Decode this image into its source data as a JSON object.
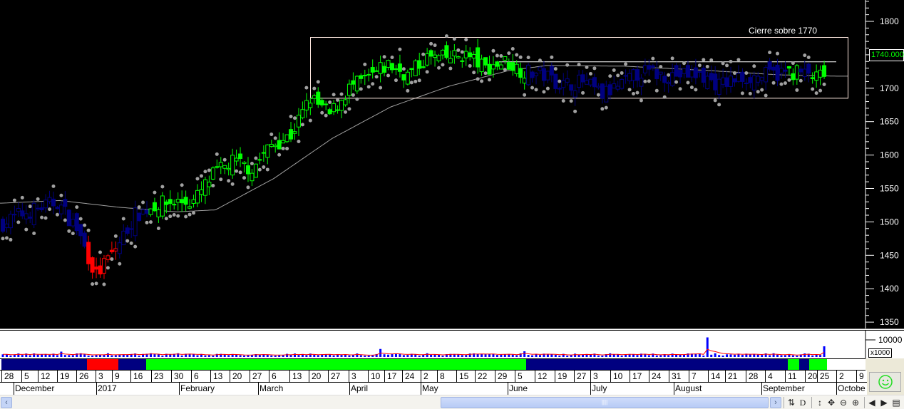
{
  "chart_data": {
    "type": "candlestick",
    "title": "",
    "annotation_label": "Cierre sobre 1770",
    "annotation_box_price": [
      1685,
      1776
    ],
    "reference_line_price": 1740,
    "current_price_label": "1740.000",
    "ylim": [
      1340,
      1830
    ],
    "y_ticks": [
      "1800",
      "1750",
      "1700",
      "1650",
      "1600",
      "1550",
      "1500",
      "1450",
      "1400",
      "1350"
    ],
    "y_tick_values": [
      1800,
      1750,
      1700,
      1650,
      1600,
      1550,
      1500,
      1450,
      1400,
      1350
    ],
    "start_close": 1495,
    "weekly_closes": [
      1510,
      1520,
      1530,
      1490,
      1420,
      1460,
      1510,
      1525,
      1530,
      1530,
      1570,
      1590,
      1580,
      1615,
      1630,
      1685,
      1660,
      1700,
      1715,
      1735,
      1720,
      1745,
      1745,
      1750,
      1730,
      1740,
      1725,
      1720,
      1705,
      1710,
      1690,
      1705,
      1725,
      1720,
      1720,
      1720,
      1705,
      1715,
      1718,
      1722,
      1725,
      1715,
      1730,
      1740
    ],
    "moving_average": [
      [
        0,
        1528
      ],
      [
        3,
        1532
      ],
      [
        6,
        1522
      ],
      [
        9,
        1515
      ],
      [
        11,
        1518
      ],
      [
        14,
        1565
      ],
      [
        17,
        1625
      ],
      [
        20,
        1672
      ],
      [
        23,
        1703
      ],
      [
        26,
        1726
      ],
      [
        28,
        1734
      ],
      [
        32,
        1733
      ],
      [
        36,
        1727
      ],
      [
        40,
        1720
      ],
      [
        43,
        1718
      ]
    ],
    "regime": [
      {
        "from": 0,
        "to": 4.4,
        "color": "#000080"
      },
      {
        "from": 4.4,
        "to": 6.0,
        "color": "#ff0000"
      },
      {
        "from": 6.0,
        "to": 7.45,
        "color": "#000080"
      },
      {
        "from": 7.45,
        "to": 26.95,
        "color": "#00ff00"
      },
      {
        "from": 26.95,
        "to": 40.4,
        "color": "#000080"
      },
      {
        "from": 40.4,
        "to": 41.0,
        "color": "#00ff00"
      },
      {
        "from": 41.0,
        "to": 41.5,
        "color": "#000080"
      },
      {
        "from": 41.5,
        "to": 42.4,
        "color": "#00ff00"
      }
    ],
    "volume": {
      "axis_label": "10000",
      "multiplier_label": "x1000",
      "typical": 1500,
      "spikes": [
        {
          "week": 3.0,
          "value": 3000
        },
        {
          "week": 19.4,
          "value": 4500
        },
        {
          "week": 36.3,
          "value": 11000
        },
        {
          "week": 42.3,
          "value": 6000
        },
        {
          "week": 26.8,
          "value": 3200
        }
      ]
    },
    "x_day_labels": [
      "28",
      "5",
      "12",
      "19",
      "26",
      "3",
      "9",
      "16",
      "23",
      "30",
      "6",
      "13",
      "20",
      "27",
      "6",
      "13",
      "20",
      "27",
      "3",
      "10",
      "17",
      "24",
      "2",
      "8",
      "15",
      "22",
      "29",
      "5",
      "12",
      "19",
      "27",
      "3",
      "10",
      "17",
      "24",
      "31",
      "7",
      "14",
      "21",
      "28",
      "4",
      "11",
      "20",
      "25",
      "2",
      "9"
    ],
    "x_month_labels": [
      "December",
      "2017",
      "February",
      "March",
      "April",
      "May",
      "June",
      "July",
      "August",
      "September",
      "Octobe"
    ]
  },
  "colors": {
    "up": "#00ff00",
    "down": "#0000ff",
    "bear": "#ff0000",
    "sar": "#a0a0a0",
    "ma": "#a0a0a0",
    "volume": "#0000ff",
    "volume_ma": "#ff0000"
  }
}
